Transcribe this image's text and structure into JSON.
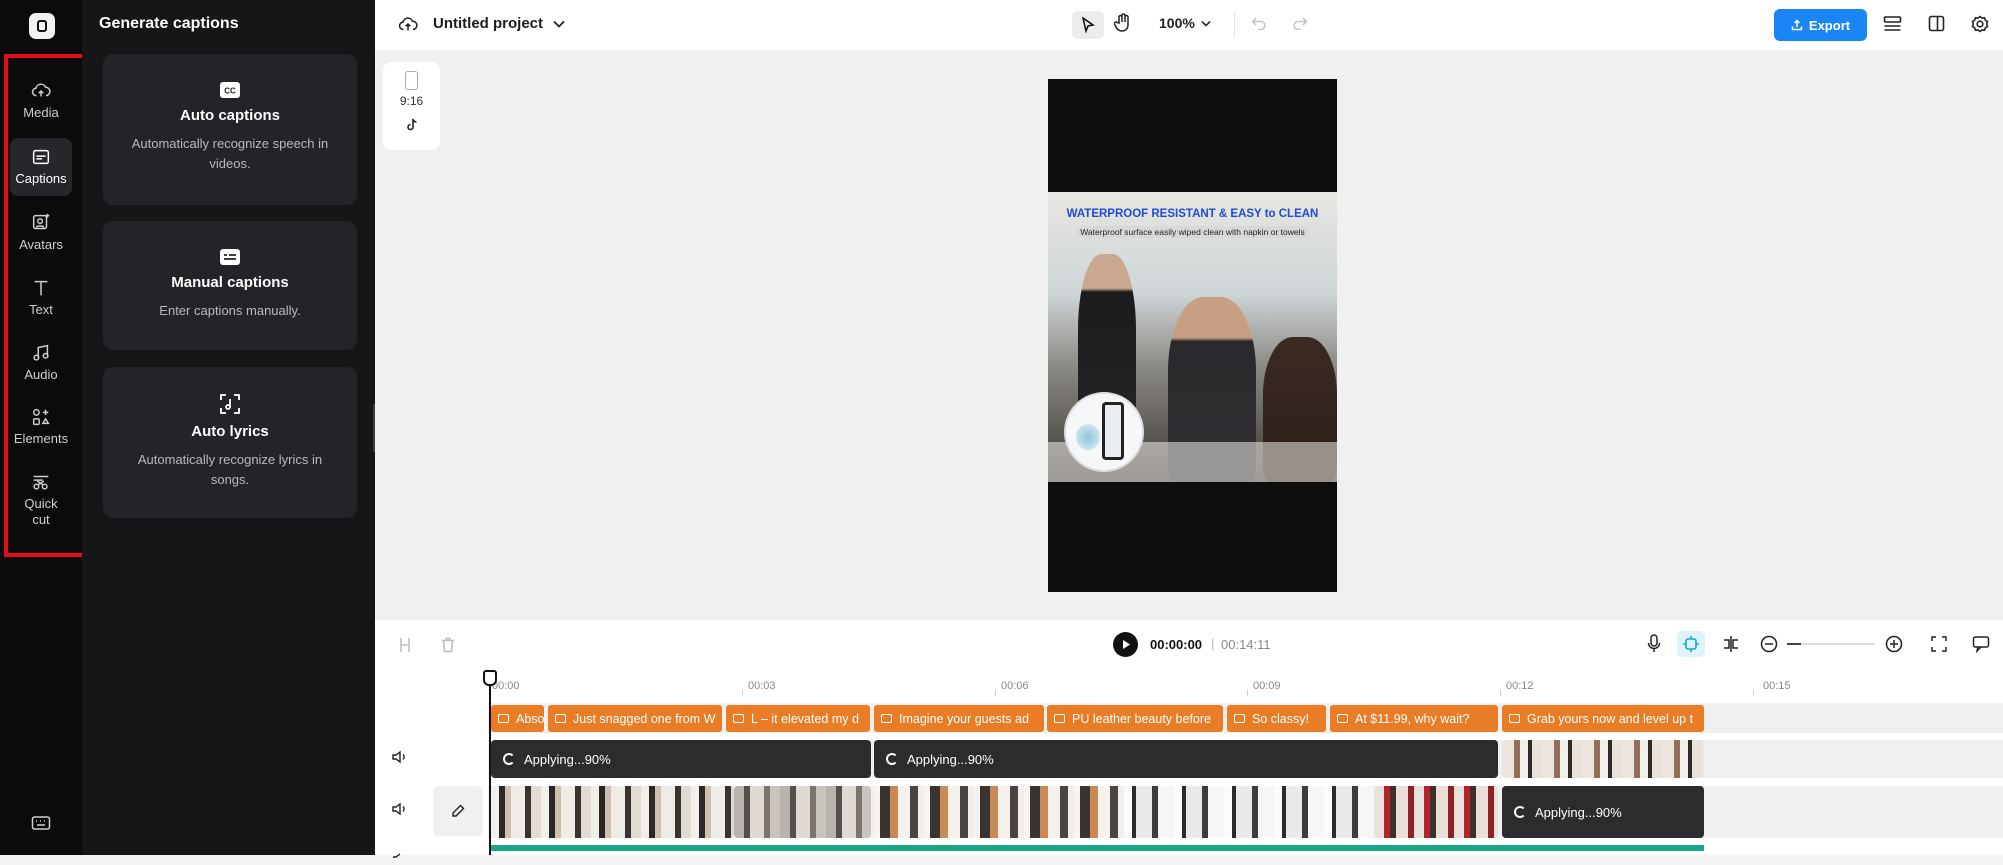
{
  "rail": {
    "items": [
      {
        "label": "Media",
        "icon": "cloud-upload-icon"
      },
      {
        "label": "Captions",
        "icon": "captions-icon"
      },
      {
        "label": "Avatars",
        "icon": "avatar-icon"
      },
      {
        "label": "Text",
        "icon": "text-icon"
      },
      {
        "label": "Audio",
        "icon": "music-icon"
      },
      {
        "label": "Elements",
        "icon": "elements-icon"
      },
      {
        "label": "Quick cut",
        "icon": "scissors-icon"
      }
    ],
    "active": "Captions"
  },
  "panel": {
    "title": "Generate captions",
    "cards": [
      {
        "title": "Auto captions",
        "desc": "Automatically recognize speech in videos.",
        "icon": "cc-icon"
      },
      {
        "title": "Manual captions",
        "desc": "Enter captions manually.",
        "icon": "keyboard-caption-icon"
      },
      {
        "title": "Auto lyrics",
        "desc": "Automatically recognize lyrics in songs.",
        "icon": "lyrics-icon"
      }
    ]
  },
  "topbar": {
    "project_title": "Untitled project",
    "zoom": "100%",
    "export_label": "Export"
  },
  "canvas": {
    "ratio": "9:16",
    "video_headline": "WATERPROOF RESISTANT & EASY to CLEAN",
    "video_sub": "Waterproof surface easily wiped clean with napkin or towels"
  },
  "controls": {
    "current_time": "00:00:00",
    "separator": "|",
    "total_time": "00:14:11"
  },
  "timeline": {
    "ruler": [
      "00:00",
      "00:03",
      "00:06",
      "00:09",
      "00:12",
      "00:15"
    ],
    "captions": [
      "Absolutely",
      "Just snagged one from W",
      "L – it elevated my d",
      "Imagine your guests ad",
      "PU leather beauty before",
      "So classy!",
      "At $11.99, why wait?",
      "Grab yours now and level up t"
    ],
    "applying": [
      "Applying...90%",
      "Applying...90%",
      "Applying...90%"
    ]
  }
}
